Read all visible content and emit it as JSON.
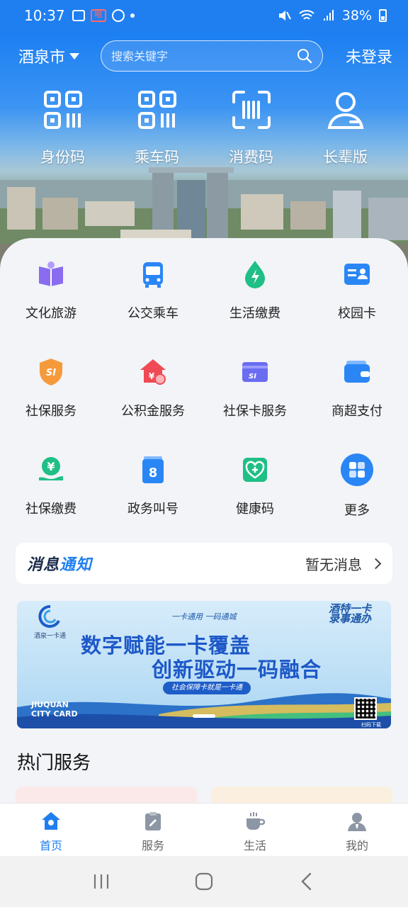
{
  "status_bar": {
    "time": "10:37",
    "battery": "38%"
  },
  "header": {
    "city": "酒泉市",
    "search_placeholder": "搜索关键字",
    "login": "未登录"
  },
  "quick_codes": [
    {
      "label": "身份码",
      "icon": "qr-code-icon"
    },
    {
      "label": "乘车码",
      "icon": "qr-code-icon"
    },
    {
      "label": "消费码",
      "icon": "scan-icon"
    },
    {
      "label": "长辈版",
      "icon": "elder-user-icon"
    }
  ],
  "services": [
    {
      "label": "文化旅游",
      "icon": "book-icon"
    },
    {
      "label": "公交乘车",
      "icon": "bus-icon"
    },
    {
      "label": "生活缴费",
      "icon": "utility-drop-icon"
    },
    {
      "label": "校园卡",
      "icon": "id-card-icon"
    },
    {
      "label": "社保服务",
      "icon": "social-security-shield-icon"
    },
    {
      "label": "公积金服务",
      "icon": "housing-fund-icon"
    },
    {
      "label": "社保卡服务",
      "icon": "social-security-card-icon"
    },
    {
      "label": "商超支付",
      "icon": "wallet-icon"
    },
    {
      "label": "社保缴费",
      "icon": "yuan-payment-icon"
    },
    {
      "label": "政务叫号",
      "icon": "queue-ticket-icon"
    },
    {
      "label": "健康码",
      "icon": "health-code-icon"
    },
    {
      "label": "更多",
      "icon": "grid-more-icon"
    }
  ],
  "notice": {
    "title_dark": "消息",
    "title_blue": "通知",
    "status": "暂无消息"
  },
  "banner": {
    "tagline": "一卡通用 一码通城",
    "corner": "酒特一卡 录事通办",
    "line1": "数字赋能一卡覆盖",
    "line2": "创新驱动一码融合",
    "pill": "社会保障卡就是一卡通",
    "brand_line1": "JIUQUAN",
    "brand_line2": "CITY CARD",
    "qr_caption": "扫码下载"
  },
  "hot_services": {
    "title": "热门服务"
  },
  "bottom_nav": [
    {
      "label": "首页",
      "icon": "home-icon",
      "active": true
    },
    {
      "label": "服务",
      "icon": "clipboard-icon",
      "active": false
    },
    {
      "label": "生活",
      "icon": "coffee-cup-icon",
      "active": false
    },
    {
      "label": "我的",
      "icon": "profile-icon",
      "active": false
    }
  ],
  "colors": {
    "primary": "#1f7ff0",
    "background": "#f2f4f7"
  }
}
